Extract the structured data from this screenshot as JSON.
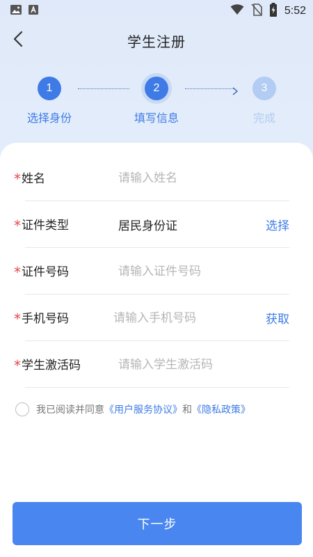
{
  "status_bar": {
    "time": "5:52",
    "icons": [
      "image-icon",
      "font-a-icon",
      "wifi-icon",
      "no-sim-icon",
      "battery-charging-icon"
    ]
  },
  "header": {
    "title": "学生注册",
    "back_icon": "chevron-left-icon"
  },
  "stepper": {
    "steps": [
      {
        "number": "1",
        "label": "选择身份",
        "state": "done"
      },
      {
        "number": "2",
        "label": "填写信息",
        "state": "active"
      },
      {
        "number": "3",
        "label": "完成",
        "state": "pending"
      }
    ]
  },
  "form": {
    "required_mark": "*",
    "fields": [
      {
        "label": "姓名",
        "placeholder": "请输入姓名",
        "value": ""
      },
      {
        "label": "证件类型",
        "value": "居民身份证",
        "action": "选择"
      },
      {
        "label": "证件号码",
        "placeholder": "请输入证件号码",
        "value": ""
      },
      {
        "label": "手机号码",
        "placeholder": "请输入手机号码",
        "value": "",
        "action": "获取"
      },
      {
        "label": "学生激活码",
        "placeholder": "请输入学生激活码",
        "value": ""
      }
    ]
  },
  "agreement": {
    "prefix": "我已阅读并同意",
    "terms_link": "《用户服务协议》",
    "connector": "和",
    "privacy_link": "《隐私政策》",
    "checked": false
  },
  "footer": {
    "next_label": "下一步"
  },
  "colors": {
    "accent": "#4a86f0",
    "link": "#3d7be5",
    "required": "#e5484d",
    "step_done": "#3f7be6",
    "step_pending": "#b3ccf3"
  }
}
